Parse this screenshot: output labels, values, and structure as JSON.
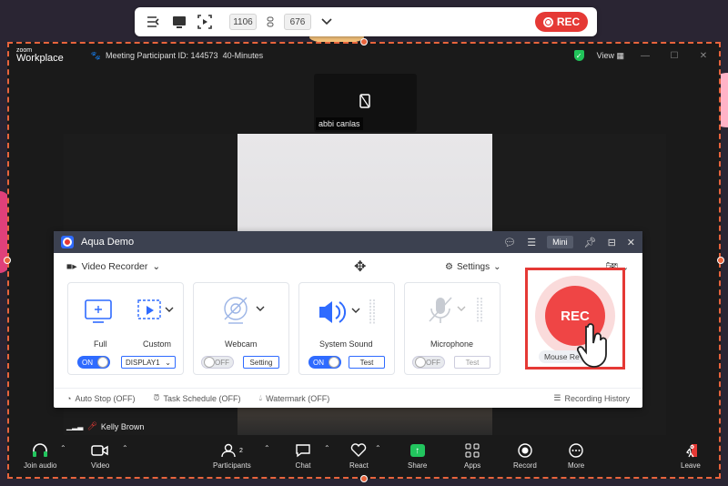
{
  "toolbar": {
    "width": "1106",
    "height": "676",
    "rec_label": "REC"
  },
  "zoom": {
    "logo_small": "zoom",
    "logo_big": "Workplace",
    "meeting_id": "Meeting Participant ID: 144573",
    "duration": "40-Minutes",
    "view_label": "View",
    "participant_name": "abbi canlas",
    "speaker_name": "Kelly Brown",
    "participants_count": "2",
    "tools": [
      {
        "label": "Join audio",
        "icon": "headphones-icon"
      },
      {
        "label": "Video",
        "icon": "video-camera-icon"
      },
      {
        "label": "Participants",
        "icon": "participants-icon"
      },
      {
        "label": "Chat",
        "icon": "chat-icon"
      },
      {
        "label": "React",
        "icon": "heart-icon"
      },
      {
        "label": "Share",
        "icon": "share-icon"
      },
      {
        "label": "Apps",
        "icon": "apps-icon"
      },
      {
        "label": "Record",
        "icon": "record-icon"
      },
      {
        "label": "More",
        "icon": "more-icon"
      },
      {
        "label": "Leave",
        "icon": "leave-icon"
      }
    ]
  },
  "aqua": {
    "title": "Aqua Demo",
    "mini_label": "Mini",
    "mode_label": "Video Recorder",
    "settings_label": "Settings",
    "full_label": "Full",
    "custom_label": "Custom",
    "display_value": "DISPLAY1",
    "webcam_label": "Webcam",
    "webcam_setting": "Setting",
    "system_sound_label": "System Sound",
    "system_test": "Test",
    "microphone_label": "Microphone",
    "mic_test": "Test",
    "on_label": "ON",
    "off_label": "OFF",
    "rec_label": "REC",
    "mouse_label": "Mouse Re",
    "auto_stop": "Auto Stop (OFF)",
    "task_schedule": "Task Schedule (OFF)",
    "watermark": "Watermark (OFF)",
    "recording_history": "Recording History"
  }
}
